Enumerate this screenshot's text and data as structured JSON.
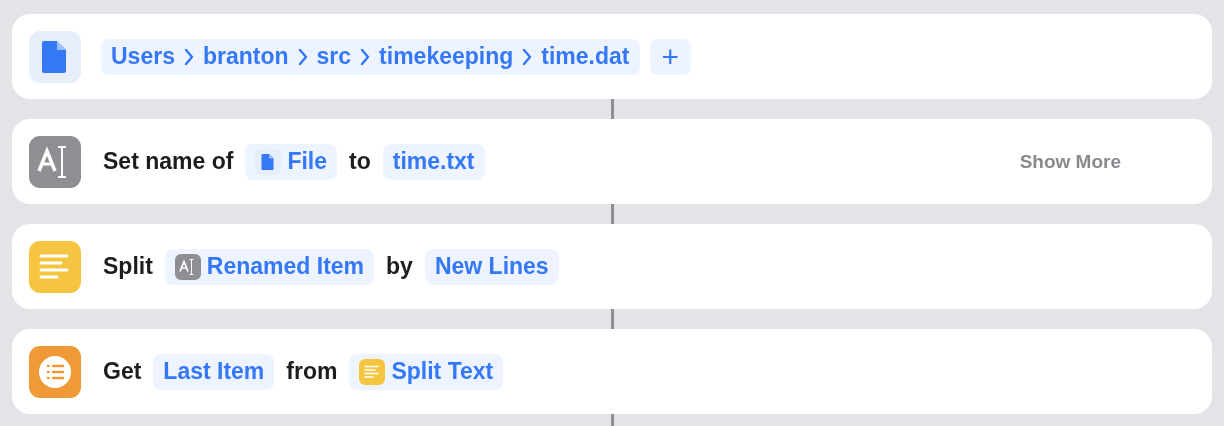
{
  "actions": [
    {
      "kind": "file",
      "parts": [
        {
          "kind": "path",
          "segments": [
            "Users",
            "branton",
            "src",
            "timekeeping",
            "time.dat"
          ]
        },
        {
          "kind": "add",
          "label": "+"
        }
      ]
    },
    {
      "kind": "rename",
      "show_more": "Show More",
      "parts": [
        {
          "kind": "text",
          "text": "Set name of"
        },
        {
          "kind": "file_ref",
          "text": "File"
        },
        {
          "kind": "text",
          "text": "to"
        },
        {
          "kind": "token",
          "text": "time.txt"
        }
      ]
    },
    {
      "kind": "split",
      "parts": [
        {
          "kind": "text",
          "text": "Split"
        },
        {
          "kind": "rename_ref",
          "text": "Renamed Item"
        },
        {
          "kind": "text",
          "text": "by"
        },
        {
          "kind": "token",
          "text": "New Lines"
        }
      ]
    },
    {
      "kind": "list",
      "parts": [
        {
          "kind": "text",
          "text": "Get"
        },
        {
          "kind": "token",
          "text": "Last Item"
        },
        {
          "kind": "text",
          "text": "from"
        },
        {
          "kind": "split_ref",
          "text": "Split Text"
        }
      ]
    }
  ]
}
